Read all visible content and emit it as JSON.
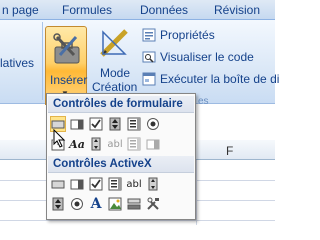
{
  "tabs": [
    "n page",
    "Formules",
    "Données",
    "Révision"
  ],
  "ribbon": {
    "left_partial_label": "latives",
    "inserer_label": "Insérer",
    "mode_creation_line1": "Mode",
    "mode_creation_line2": "Création",
    "proprietes_label": "Propriétés",
    "visualiser_code_label": "Visualiser le code",
    "executer_label": "Exécuter la boîte de di",
    "group_caption": "es"
  },
  "sheet": {
    "column_header": "F"
  },
  "dropdown": {
    "section1_title": "Contrôles de formulaire",
    "section2_title": "Contrôles ActiveX",
    "form_controls": [
      "button-icon",
      "combo-box-icon",
      "checkbox-icon",
      "spin-button-icon",
      "list-box-icon",
      "option-button-icon",
      "group-box-icon",
      "label-icon",
      "scroll-bar-icon",
      "text-field-icon",
      "combo-list-edit-icon",
      "combo-drop-down-edit-icon"
    ],
    "activex_controls": [
      "command-button-icon",
      "combo-box-icon",
      "checkbox-icon",
      "list-box-icon",
      "text-box-icon",
      "scroll-bar-icon",
      "spin-button-icon",
      "option-button-icon",
      "label-icon",
      "image-icon",
      "toggle-button-icon",
      "more-controls-icon"
    ],
    "label_control_text": "Aa",
    "abl_text": "abl",
    "activex_label_text": "A"
  }
}
